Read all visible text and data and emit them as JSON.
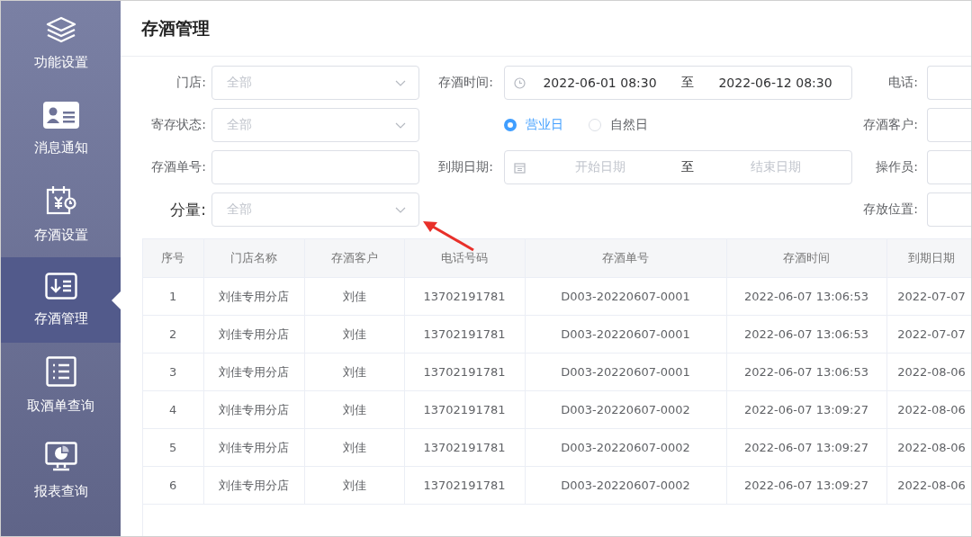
{
  "sidebar": {
    "items": [
      {
        "label": "功能设置",
        "selected": false
      },
      {
        "label": "消息通知",
        "selected": false
      },
      {
        "label": "存酒设置",
        "selected": false
      },
      {
        "label": "存酒管理",
        "selected": true
      },
      {
        "label": "取酒单查询",
        "selected": false
      },
      {
        "label": "报表查询",
        "selected": false
      }
    ]
  },
  "page_title": "存酒管理",
  "filters": [
    {
      "left": {
        "kind": "select",
        "label": "门店:",
        "emphasized": false,
        "placeholder": "全部"
      },
      "middle": {
        "kind": "datetime_range",
        "label": "存酒时间:",
        "emphasized": false,
        "start_value": "2022-06-01 08:30",
        "separator": "至",
        "end_value": "2022-06-12 08:30"
      },
      "right": {
        "kind": "input",
        "label": "电话:",
        "emphasized": false
      }
    },
    {
      "left": {
        "kind": "select",
        "label": "寄存状态:",
        "emphasized": false,
        "placeholder": "全部"
      },
      "middle": {
        "kind": "radio",
        "options": [
          {
            "label": "营业日",
            "selected": true
          },
          {
            "label": "自然日",
            "selected": false
          }
        ]
      },
      "right": {
        "kind": "input",
        "label": "存酒客户:",
        "emphasized": false
      }
    },
    {
      "left": {
        "kind": "input",
        "label": "存酒单号:",
        "emphasized": false
      },
      "middle": {
        "kind": "date_range",
        "label": "到期日期:",
        "emphasized": false,
        "start_placeholder": "开始日期",
        "separator": "至",
        "end_placeholder": "结束日期"
      },
      "right": {
        "kind": "input",
        "label": "操作员:",
        "emphasized": false
      }
    },
    {
      "left": {
        "kind": "select",
        "label": "分量:",
        "emphasized": true,
        "placeholder": "全部"
      },
      "right": {
        "kind": "input",
        "label": "存放位置:",
        "emphasized": false
      }
    }
  ],
  "table": {
    "columns": [
      "序号",
      "门店名称",
      "存酒客户",
      "电话号码",
      "存酒单号",
      "存酒时间",
      "到期日期"
    ],
    "rows": [
      [
        "1",
        "刘佳专用分店",
        "刘佳",
        "13702191781",
        "D003-20220607-0001",
        "2022-06-07 13:06:53",
        "2022-07-07"
      ],
      [
        "2",
        "刘佳专用分店",
        "刘佳",
        "13702191781",
        "D003-20220607-0001",
        "2022-06-07 13:06:53",
        "2022-07-07"
      ],
      [
        "3",
        "刘佳专用分店",
        "刘佳",
        "13702191781",
        "D003-20220607-0001",
        "2022-06-07 13:06:53",
        "2022-08-06"
      ],
      [
        "4",
        "刘佳专用分店",
        "刘佳",
        "13702191781",
        "D003-20220607-0002",
        "2022-06-07 13:09:27",
        "2022-08-06"
      ],
      [
        "5",
        "刘佳专用分店",
        "刘佳",
        "13702191781",
        "D003-20220607-0002",
        "2022-06-07 13:09:27",
        "2022-08-06"
      ],
      [
        "6",
        "刘佳专用分店",
        "刘佳",
        "13702191781",
        "D003-20220607-0002",
        "2022-06-07 13:09:27",
        "2022-08-06"
      ]
    ]
  }
}
